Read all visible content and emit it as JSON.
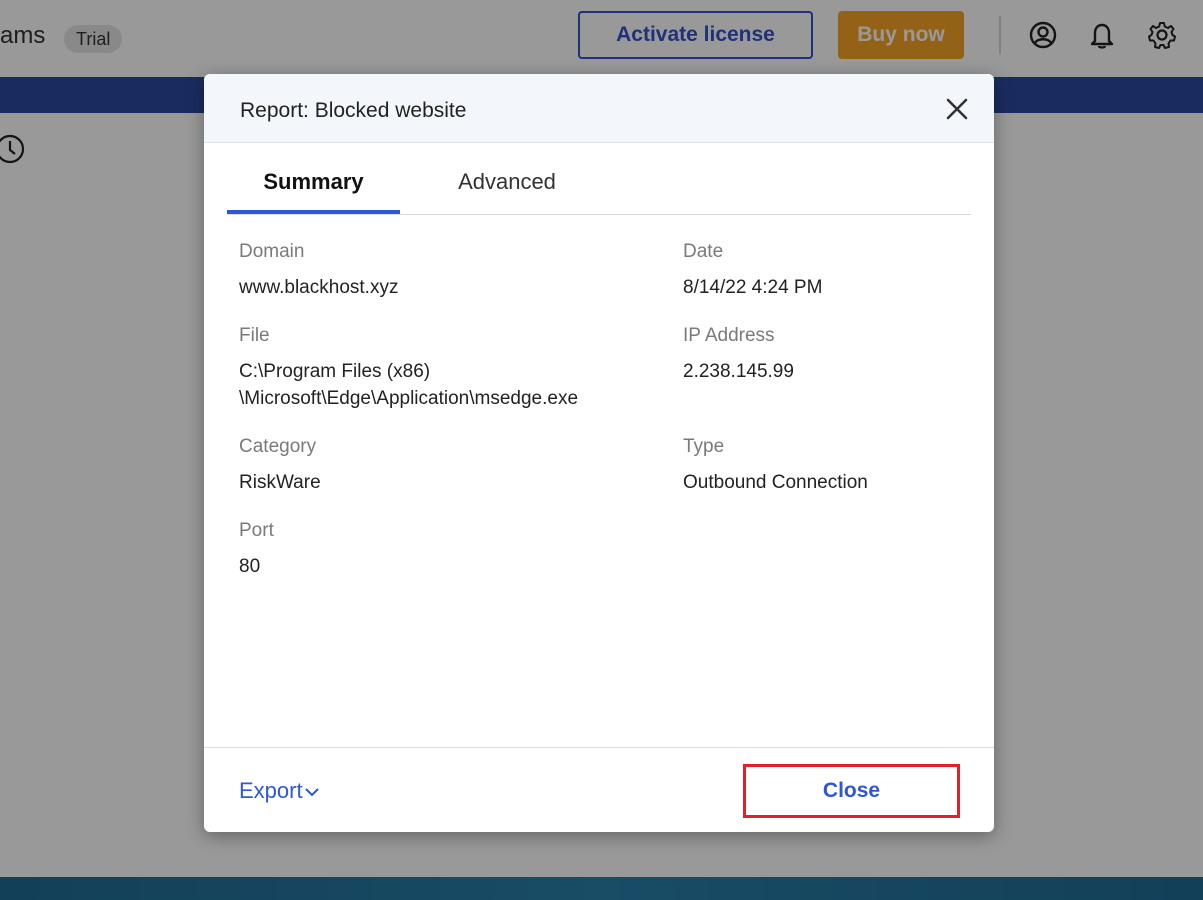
{
  "app": {
    "title_fragment": "ams",
    "trial_badge": "Trial",
    "activate_label": "Activate license",
    "buy_label": "Buy now",
    "icons": [
      "account-icon",
      "bell-icon",
      "gear-icon",
      "clock-icon"
    ]
  },
  "dialog": {
    "title": "Report: Blocked website",
    "tabs": [
      {
        "label": "Summary",
        "active": true
      },
      {
        "label": "Advanced",
        "active": false
      }
    ],
    "fields": {
      "domain": {
        "label": "Domain",
        "value": "www.blackhost.xyz"
      },
      "date": {
        "label": "Date",
        "value": "8/14/22 4:24 PM"
      },
      "file": {
        "label": "File",
        "value_line1": "C:\\Program Files (x86)",
        "value_line2": "\\Microsoft\\Edge\\Application\\msedge.exe"
      },
      "ip": {
        "label": "IP Address",
        "value": "2.238.145.99"
      },
      "category": {
        "label": "Category",
        "value": "RiskWare"
      },
      "type": {
        "label": "Type",
        "value": "Outbound Connection"
      },
      "port": {
        "label": "Port",
        "value": "80"
      }
    },
    "export_label": "Export",
    "close_label": "Close"
  },
  "colors": {
    "accent": "#2f57d4",
    "buy": "#f5a327",
    "highlight_border": "#e0202a",
    "banner": "#2c4a9e"
  }
}
